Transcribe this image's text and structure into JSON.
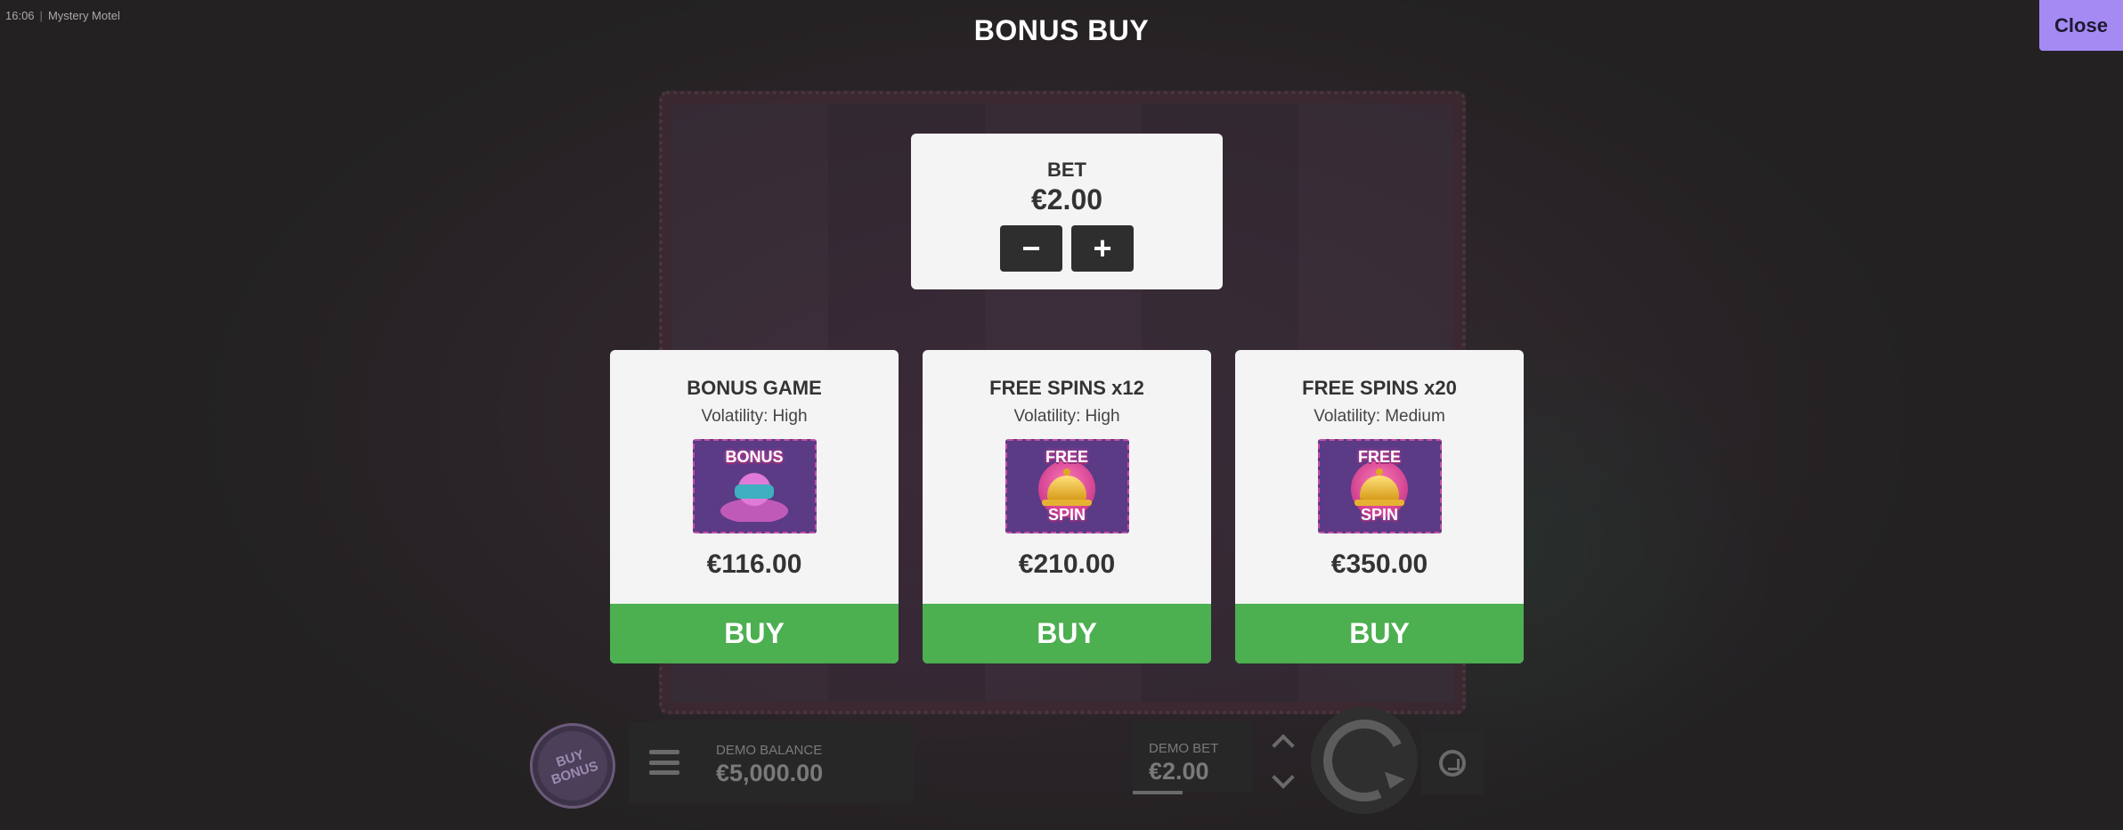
{
  "status_bar": {
    "time": "16:06",
    "separator": "|",
    "game_name": "Mystery Motel"
  },
  "modal": {
    "title": "BONUS BUY",
    "close_label": "Close",
    "bet": {
      "label": "BET",
      "value": "€2.00",
      "decrease_icon": "minus-icon",
      "increase_icon": "plus-icon"
    },
    "options": [
      {
        "title": "BONUS GAME",
        "volatility_label": "Volatility:",
        "volatility": "High",
        "art_text_top": "BONUS",
        "art_text_bottom": "",
        "price": "€116.00",
        "buy_label": "BUY"
      },
      {
        "title": "FREE SPINS x12",
        "volatility_label": "Volatility:",
        "volatility": "High",
        "art_text_top": "FREE",
        "art_text_bottom": "SPIN",
        "price": "€210.00",
        "buy_label": "BUY"
      },
      {
        "title": "FREE SPINS x20",
        "volatility_label": "Volatility:",
        "volatility": "Medium",
        "art_text_top": "FREE",
        "art_text_bottom": "SPIN",
        "price": "€350.00",
        "buy_label": "BUY"
      }
    ]
  },
  "game_controls": {
    "buy_bonus_label": "BUY BONUS",
    "menu_icon": "hamburger-icon",
    "balance_label": "DEMO BALANCE",
    "balance_value": "€5,000.00",
    "bet_label": "DEMO BET",
    "bet_value": "€2.00",
    "spin_icon": "spin-icon",
    "autoplay_icon": "autoplay-icon"
  },
  "colors": {
    "accent_close": "#a58af4",
    "buy_green": "#4caf50",
    "panel_bg": "#f4f4f4",
    "dark_button": "#2e2e2e"
  }
}
